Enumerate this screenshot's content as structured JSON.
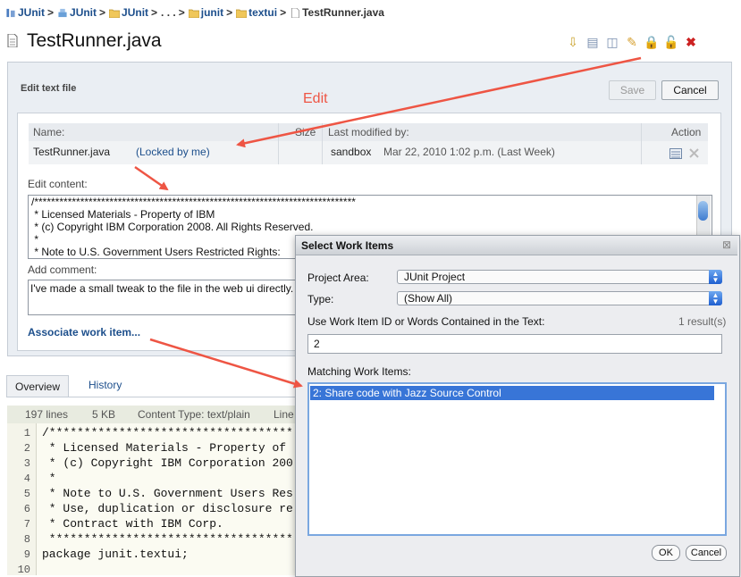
{
  "breadcrumb": {
    "items": [
      "JUnit",
      "JUnit",
      "JUnit",
      ". . .",
      "junit",
      "textui"
    ],
    "current": "TestRunner.java",
    "separator": ">"
  },
  "page_title": "TestRunner.java",
  "toolbar": {
    "icons": [
      "download-icon",
      "compare-icon",
      "history-icon",
      "edit-pencil-icon",
      "lock-icon",
      "unlock-icon",
      "delete-icon"
    ]
  },
  "edit_panel": {
    "heading": "Edit text file",
    "save_label": "Save",
    "cancel_label": "Cancel",
    "table": {
      "headers": {
        "name": "Name:",
        "size": "Size",
        "modified": "Last modified by:",
        "action": "Action"
      },
      "row": {
        "name": "TestRunner.java",
        "lock_status": "(Locked by me)",
        "user": "sandbox",
        "date": "Mar 22, 2010 1:02 p.m. (Last Week)"
      }
    },
    "edit_content_label": "Edit content:",
    "content_lines": [
      "/*****************************************************************************",
      " * Licensed Materials - Property of IBM",
      " * (c) Copyright IBM Corporation 2008. All Rights Reserved.",
      " *",
      " * Note to U.S. Government Users Restricted Rights:"
    ],
    "add_comment_label": "Add comment:",
    "comment_text": "I've made a small tweak to the file in the web ui directly.",
    "associate_link": "Associate work item..."
  },
  "tabs": [
    {
      "label": "Overview",
      "active": true
    },
    {
      "label": "History",
      "active": false
    }
  ],
  "info_bar": {
    "lines": "197 lines",
    "size": "5 KB",
    "content_type": "Content Type: text/plain",
    "line_prefix": "Line"
  },
  "code": {
    "lines": [
      {
        "num": "1",
        "text": "/***********************************"
      },
      {
        "num": "2",
        "text": " * Licensed Materials - Property of"
      },
      {
        "num": "3",
        "text": " * (c) Copyright IBM Corporation 200"
      },
      {
        "num": "4",
        "text": " *"
      },
      {
        "num": "5",
        "text": " * Note to U.S. Government Users Res"
      },
      {
        "num": "6",
        "text": " * Use, duplication or disclosure re"
      },
      {
        "num": "7",
        "text": " * Contract with IBM Corp."
      },
      {
        "num": "8",
        "text": " ***********************************"
      },
      {
        "num": "9",
        "text": "package junit.textui;"
      },
      {
        "num": "10",
        "text": ""
      }
    ]
  },
  "dialog": {
    "title": "Select Work Items",
    "close_glyph": "⊠",
    "project_area_label": "Project Area:",
    "project_area_value": "JUnit Project",
    "type_label": "Type:",
    "type_value": "(Show All)",
    "search_label": "Use Work Item ID or Words Contained in the Text:",
    "result_count": "1 result(s)",
    "search_value": "2",
    "matching_label": "Matching Work Items:",
    "matching_items": [
      "2: Share code with Jazz Source Control"
    ],
    "ok_label": "OK",
    "cancel_label": "Cancel"
  },
  "annotation": {
    "label": "Edit",
    "color": "#ee5544"
  },
  "colors": {
    "link": "#1d4f8c",
    "panel_bg": "#eaeef3",
    "selection": "#3875d7"
  }
}
